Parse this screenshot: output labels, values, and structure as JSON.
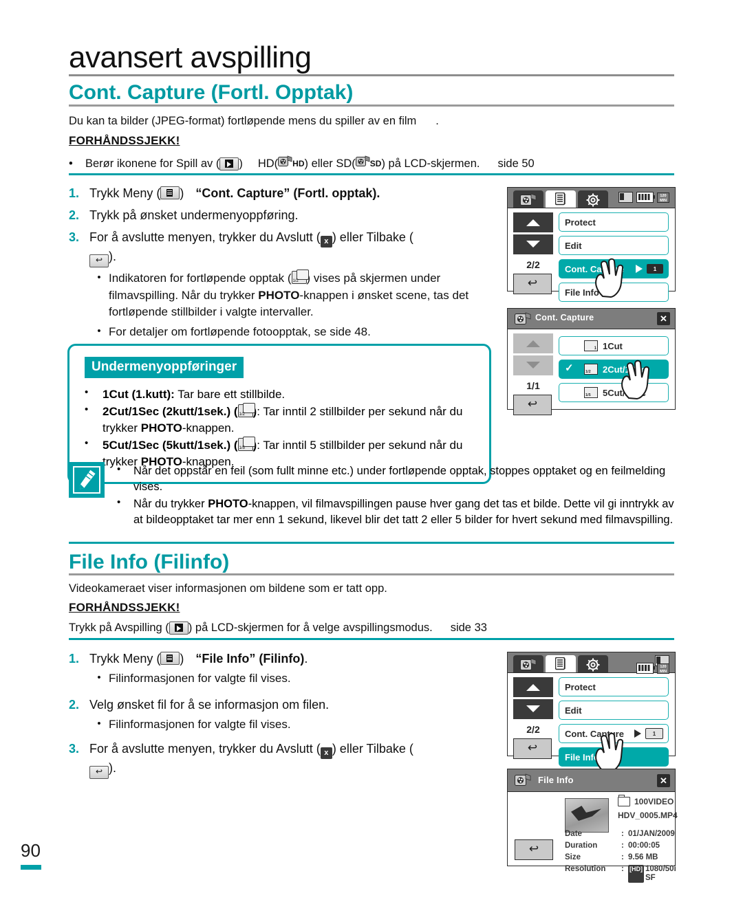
{
  "page": {
    "chapter_title": "avansert avspilling",
    "page_number": "90"
  },
  "section1": {
    "title": "Cont. Capture (Fortl. Opptak)",
    "intro": "Du kan ta bilder (JPEG-format) fortløpende mens du spiller av en film",
    "intro_tail": ".",
    "precheck_label": "FORHÅNDSSJEKK!",
    "precheck_bullet_a": "Berør ikonene for Spill av (",
    "precheck_bullet_b": ")",
    "precheck_bullet_c": "HD(",
    "precheck_bullet_d": "HD",
    "precheck_bullet_e": ") eller SD(",
    "precheck_bullet_f": "SD",
    "precheck_bullet_g": ") på LCD-skjermen.",
    "precheck_ref": "side 50",
    "steps": [
      {
        "num": "1.",
        "text_a": "Trykk Meny (",
        "text_b": ")",
        "bold": "“Cont. Capture”",
        "text_c": " (Fortl. opptak).",
        "subs": []
      },
      {
        "num": "2.",
        "text_a": "Trykk på ønsket undermenyoppføring.",
        "subs": []
      },
      {
        "num": "3.",
        "text_a": "For å avslutte menyen, trykker du Avslutt (",
        "text_b": ") eller Tilbake (",
        "text_c": ").",
        "subs": [
          {
            "pre": "Indikatoren for fortløpende opptak (",
            "post": ") vises på skjermen under filmavspilling. Når du trykker ",
            "bold": "PHOTO",
            "tail": "-knappen i ønsket scene, tas det fortløpende stillbilder i valgte intervaller."
          },
          {
            "pre": "For detaljer om fortløpende fotoopptak, se side 48.",
            "post": "",
            "bold": "",
            "tail": ""
          }
        ]
      }
    ],
    "submenu": {
      "heading": "Undermenyoppføringer",
      "items": [
        {
          "bold": "1Cut (1.kutt):",
          "rest": " Tar bare ett stillbilde.",
          "icon": false
        },
        {
          "bold": "2Cut/1Sec (2kutt/1sek.)",
          "rest": ": Tar inntil 2 stillbilder per sekund når du trykker ",
          "bold2": "PHOTO",
          "tail": "-knappen.",
          "icon": true,
          "icon_label": "1/2"
        },
        {
          "bold": "5Cut/1Sec (5kutt/1sek.)",
          "rest": ": Tar inntil 5 stillbilder per sekund når du trykker ",
          "bold2": "PHOTO",
          "tail": "-knappen.",
          "icon": true,
          "icon_label": "1/5"
        }
      ]
    },
    "notes": [
      {
        "text": "Når det oppstår en feil (som fullt minne etc.) under fortløpende opptak, stoppes opptaket og en feilmelding vises."
      },
      {
        "pre": "Når du trykker ",
        "bold": "PHOTO",
        "tail": "-knappen, vil filmavspillingen pause hver gang det tas et bilde. Dette vil gi inntrykk av at bildeopptaket tar mer enn 1 sekund, likevel blir det tatt 2 eller 5 bilder for hvert sekund med filmavspilling."
      }
    ]
  },
  "section2": {
    "title": "File Info (Filinfo)",
    "intro": "Videokameraet viser informasjonen om bildene som er tatt opp.",
    "precheck_label": "FORHÅNDSSJEKK!",
    "precheck_a": "Trykk på Avspilling (",
    "precheck_b": ") på LCD-skjermen for å velge avspillingsmodus.",
    "precheck_ref": "side 33",
    "steps": [
      {
        "num": "1.",
        "text_a": "Trykk Meny (",
        "text_b": ")",
        "bold": "“File Info” (Filinfo)",
        "text_c": ".",
        "subs": [
          "Filinformasjonen for valgte fil vises."
        ]
      },
      {
        "num": "2.",
        "text_a": "Velg ønsket fil for å se informasjon om filen.",
        "subs": [
          "Filinformasjonen for valgte fil vises."
        ]
      },
      {
        "num": "3.",
        "text_a": "For å avslutte menyen, trykker du Avslutt (",
        "text_b": ") eller Tilbake (",
        "text_c": ").",
        "subs": []
      }
    ]
  },
  "lcd_screens": {
    "screen1": {
      "name": "cont-capture-menu",
      "pager": "2/2",
      "back": "↩",
      "status": {
        "min_top": "120",
        "min_bottom": "MIN"
      },
      "items": [
        {
          "label": "Protect",
          "selected": false,
          "arrow": false,
          "chip": ""
        },
        {
          "label": "Edit",
          "selected": false,
          "arrow": false,
          "chip": ""
        },
        {
          "label": "Cont. Capture",
          "selected": true,
          "arrow": true,
          "chip": "1"
        },
        {
          "label": "File Info",
          "selected": false,
          "arrow": false,
          "chip": ""
        }
      ]
    },
    "screen2": {
      "name": "cont-capture-options",
      "title": "Cont. Capture",
      "pager": "1/1",
      "back": "↩",
      "close": "✕",
      "items": [
        {
          "label": "1Cut",
          "selected": false,
          "checked": false,
          "icon_label": "1"
        },
        {
          "label": "2Cut/1Sec",
          "selected": true,
          "checked": true,
          "icon_label": "1/2"
        },
        {
          "label": "5Cut/1Sec",
          "selected": false,
          "checked": false,
          "icon_label": "1/5"
        }
      ]
    },
    "screen3": {
      "name": "file-info-menu",
      "pager": "2/2",
      "back": "↩",
      "status": {
        "min_top": "120",
        "min_bottom": "MIN"
      },
      "items": [
        {
          "label": "Protect",
          "selected": false,
          "arrow": false,
          "chip": ""
        },
        {
          "label": "Edit",
          "selected": false,
          "arrow": false,
          "chip": ""
        },
        {
          "label": "Cont. Capture",
          "selected": false,
          "arrow": true,
          "chip": "1"
        },
        {
          "label": "File Info",
          "selected": true,
          "arrow": false,
          "chip": ""
        }
      ]
    },
    "screen4": {
      "name": "file-info-detail",
      "title": "File Info",
      "close": "✕",
      "back": "↩",
      "folder": "100VIDEO",
      "filename": "HDV_0005.MP4",
      "rows": [
        {
          "key": "Date",
          "sep": ":",
          "value": "01/JAN/2009"
        },
        {
          "key": "Duration",
          "sep": ":",
          "value": "00:00:05"
        },
        {
          "key": "Size",
          "sep": ":",
          "value": "9.56 MB"
        },
        {
          "key": "Resolution",
          "sep": ":",
          "value": "1080/50i SF",
          "prefix": "[HD]"
        }
      ]
    }
  },
  "colors": {
    "teal": "#00a0a8",
    "lcd_teal": "#00a9a9",
    "bar_gray": "#7d7d7d",
    "dark": "#3a3a3a"
  }
}
